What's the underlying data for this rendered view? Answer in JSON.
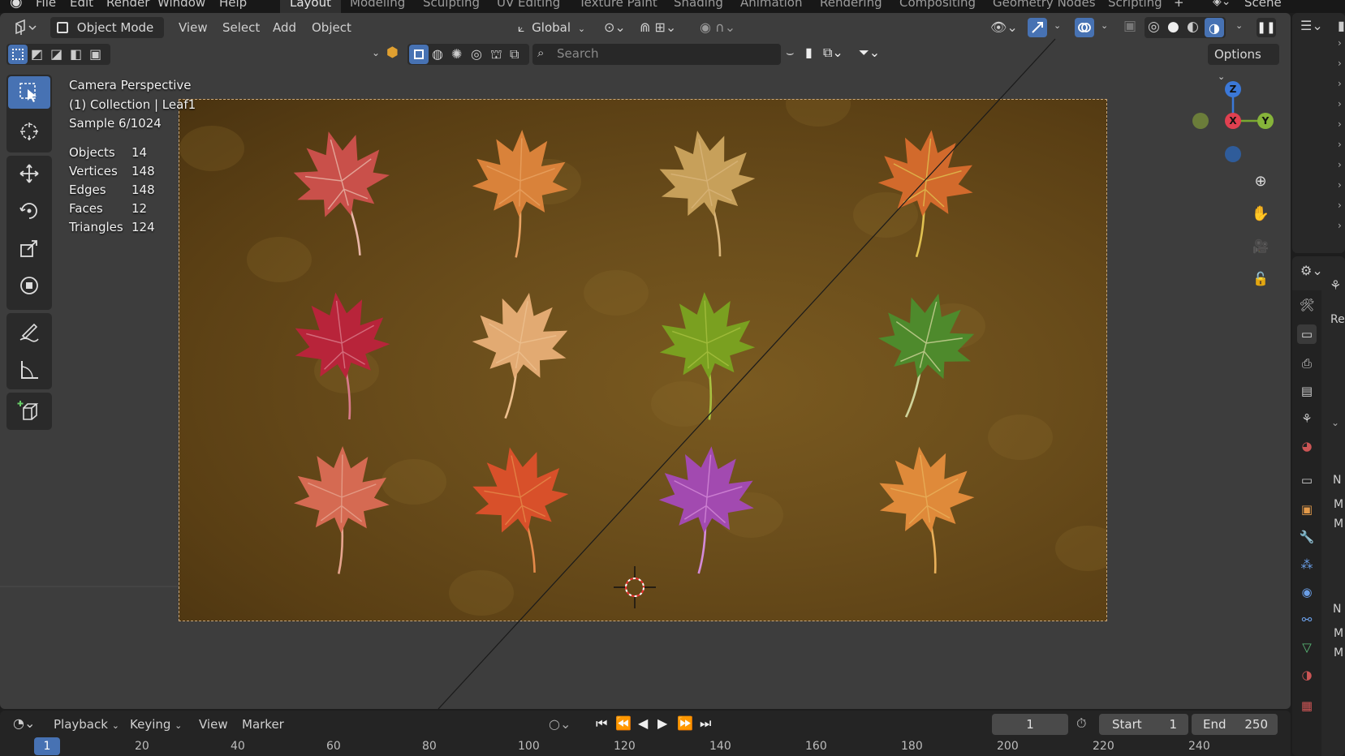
{
  "topbar": {
    "menus": [
      "File",
      "Edit",
      "Render",
      "Window",
      "Help"
    ],
    "workspaces": [
      "Layout",
      "Modeling",
      "Sculpting",
      "UV Editing",
      "Texture Paint",
      "Shading",
      "Animation",
      "Rendering",
      "Compositing",
      "Geometry Nodes",
      "Scripting"
    ],
    "active_workspace": "Layout",
    "add_tab": "+",
    "scene_label": "Scene"
  },
  "viewport_header": {
    "mode": "Object Mode",
    "menus": [
      "View",
      "Select",
      "Add",
      "Object"
    ],
    "transform_orientation": "Global",
    "search_placeholder": "Search",
    "options_label": "Options"
  },
  "overlay": {
    "view_name": "Camera Perspective",
    "collection_line": "(1) Collection | Leaf1",
    "sample": "Sample 6/1024",
    "stats": [
      {
        "label": "Objects",
        "value": "14"
      },
      {
        "label": "Vertices",
        "value": "148"
      },
      {
        "label": "Edges",
        "value": "148"
      },
      {
        "label": "Faces",
        "value": "12"
      },
      {
        "label": "Triangles",
        "value": "124"
      }
    ]
  },
  "gizmo": {
    "x": "X",
    "y": "Y",
    "z": "Z"
  },
  "leaves": [
    {
      "color": "#c9504a",
      "tip": "#e9b7a8"
    },
    {
      "color": "#d9823a",
      "tip": "#e9a262"
    },
    {
      "color": "#c7a05a",
      "tip": "#d9b57a"
    },
    {
      "color": "#d26a2c",
      "tip": "#e0c050"
    },
    {
      "color": "#b8243a",
      "tip": "#d97a8a"
    },
    {
      "color": "#e2aa72",
      "tip": "#eec08e"
    },
    {
      "color": "#7aa020",
      "tip": "#a7c040"
    },
    {
      "color": "#4e8a2c",
      "tip": "#cfd39a"
    },
    {
      "color": "#d56a52",
      "tip": "#e6a48e"
    },
    {
      "color": "#d8502a",
      "tip": "#e58a4a"
    },
    {
      "color": "#a24ab0",
      "tip": "#d48ad8"
    },
    {
      "color": "#df8a3a",
      "tip": "#e9b05a"
    }
  ],
  "right_panel": {
    "props_partial_label": "Re",
    "partial_letters": [
      "N",
      "M",
      "M",
      "N",
      "M",
      "M"
    ]
  },
  "timeline": {
    "menus": [
      "Playback",
      "Keying",
      "View",
      "Marker"
    ],
    "current_frame": "1",
    "start_label": "Start",
    "start_value": "1",
    "end_label": "End",
    "end_value": "250",
    "ruler_current": "1",
    "ruler_ticks": [
      "20",
      "40",
      "60",
      "80",
      "100",
      "120",
      "140",
      "160",
      "180",
      "200",
      "220",
      "240"
    ]
  }
}
